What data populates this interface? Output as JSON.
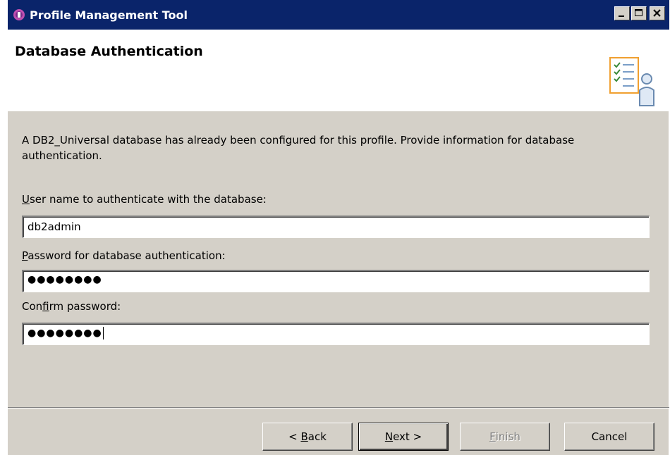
{
  "window": {
    "title": "Profile Management Tool",
    "icon": "profile-tool-icon",
    "controls": [
      "minimize",
      "maximize",
      "close"
    ]
  },
  "banner": {
    "title": "Database Authentication",
    "icon": "user-checklist-icon"
  },
  "main": {
    "description": "A DB2_Universal database has already been configured for this profile. Provide information for database authentication.",
    "fields": [
      {
        "label_mnemonic": "U",
        "label_rest": "ser name to authenticate with the database:",
        "value": "db2admin"
      },
      {
        "label_mnemonic": "P",
        "label_rest": "assword for database authentication:",
        "value": "●●●●●●●●"
      },
      {
        "label_prefix": "Con",
        "label_mnemonic": "f",
        "label_rest": "irm password:",
        "value": "●●●●●●●●"
      }
    ]
  },
  "buttons": {
    "back": {
      "prefix": "< ",
      "mnemonic": "B",
      "rest": "ack"
    },
    "next": {
      "mnemonic": "N",
      "rest": "ext >"
    },
    "finish": {
      "mnemonic": "F",
      "rest": "inish"
    },
    "cancel": {
      "label": "Cancel"
    }
  },
  "colors": {
    "titlebar": "#0a246a",
    "dialog_bg": "#d4d0c8",
    "banner_bg": "#ffffff"
  }
}
